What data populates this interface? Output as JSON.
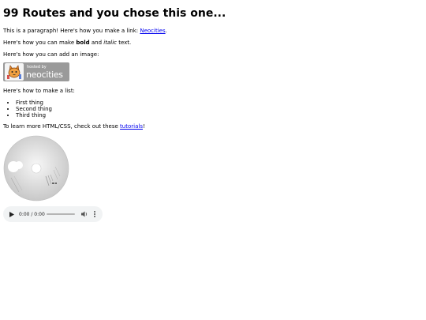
{
  "title": "99 Routes and you chose this one...",
  "p1": {
    "text": "This is a paragraph! Here's how you make a link: ",
    "link": "Neocities",
    "after": "."
  },
  "p2": {
    "pre": "Here's how you can make ",
    "bold": "bold",
    "mid": " and ",
    "italic": "italic",
    "post": " text."
  },
  "p3": "Here's how you can add an image:",
  "badge": {
    "small": "hosted by",
    "big": "neocities"
  },
  "p4": "Here's how to make a list:",
  "list": [
    "First thing",
    "Second thing",
    "Third thing"
  ],
  "p5": {
    "pre": "To learn more HTML/CSS, check out these ",
    "link": "tutorials",
    "post": "!"
  },
  "audio": {
    "time": "0:00 / 0:00",
    "play_icon": "play-icon",
    "volume_icon": "volume-icon",
    "more_icon": "more-vert-icon"
  },
  "colors": {
    "link": "#0000ee",
    "badge_bg": "#9a9a9a",
    "audio_bg": "#f1f3f4"
  }
}
